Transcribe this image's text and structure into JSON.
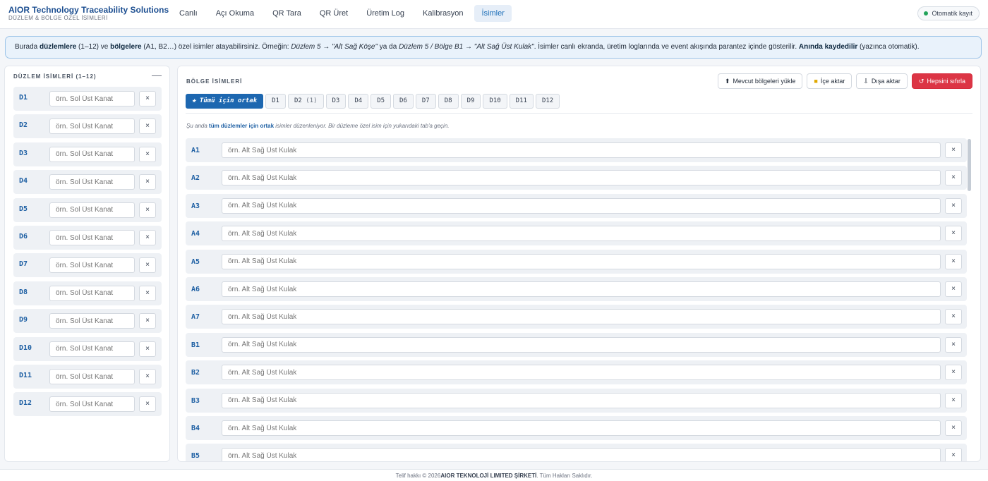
{
  "brand": {
    "title": "AIOR Technology Traceability Solutions",
    "subtitle": "DÜZLEM & BÖLGE ÖZEL İSİMLERİ"
  },
  "nav": [
    "Canlı",
    "Açı Okuma",
    "QR Tara",
    "QR Üret",
    "Üretim Log",
    "Kalibrasyon",
    "İsimler"
  ],
  "nav_active": "İsimler",
  "autosave": "Otomatik kayıt",
  "info": {
    "t1": "Burada ",
    "b1": "düzlemlere",
    "t2": " (1–12) ve ",
    "b2": "bölgelere",
    "t3": " (A1, B2…) özel isimler atayabilirsiniz. Örneğin: ",
    "i1": "Düzlem 5 → \"Alt Sağ Köşe\"",
    "t4": " ya da ",
    "i2": "Düzlem 5 / Bölge B1 → \"Alt Sağ Üst Kulak\"",
    "t5": ". İsimler canlı ekranda, üretim loglarında ve event akışında parantez içinde gösterilir. ",
    "b3": "Anında kaydedilir",
    "t6": " (yazınca otomatik)."
  },
  "left": {
    "title": "DÜZLEM İSİMLERİ (1–12)",
    "collapse": "—",
    "placeholder": "örn. Sol Üst Kanat",
    "items": [
      "D1",
      "D2",
      "D3",
      "D4",
      "D5",
      "D6",
      "D7",
      "D8",
      "D9",
      "D10",
      "D11",
      "D12"
    ]
  },
  "right": {
    "title": "BÖLGE İSİMLERİ",
    "actions": {
      "load": "Mevcut bölgeleri yükle",
      "import": "İçe aktar",
      "export": "Dışa aktar",
      "reset": "Hepsini sıfırla"
    },
    "tabs": {
      "common": "★ Tümü için ortak",
      "items": [
        "D1",
        "D2",
        "D3",
        "D4",
        "D5",
        "D6",
        "D7",
        "D8",
        "D9",
        "D10",
        "D11",
        "D12"
      ],
      "d2_count": "(1)"
    },
    "hint": {
      "t1": "Şu anda ",
      "b1": "tüm düzlemler için ortak",
      "t2": " isimler düzenleniyor. Bir düzleme özel isim için yukarıdaki tab'a geçin."
    },
    "placeholder": "örn. Alt Sağ Üst Kulak",
    "regions": [
      "A1",
      "A2",
      "A3",
      "A4",
      "A5",
      "A6",
      "A7",
      "B1",
      "B2",
      "B3",
      "B4",
      "B5"
    ]
  },
  "close_glyph": "×",
  "footer": {
    "t1": "Telif hakkı © 2026",
    "b1": "AIOR TEKNOLOJİ LIMITED ŞİRKETİ",
    "t2": ". Tüm Hakları Saklıdır."
  }
}
